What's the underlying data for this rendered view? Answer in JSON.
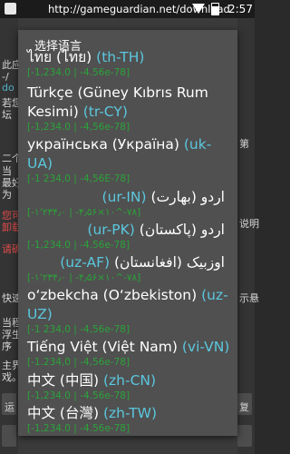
{
  "status_bar": {
    "url": "http://gameguardian.net/download",
    "time": "2:57",
    "icons": [
      "app-logo-icon",
      "wifi-icon",
      "battery-icon"
    ]
  },
  "background": {
    "fragments": [
      "此应",
      "-/",
      "do",
      "若您",
      "坛",
      "二个",
      "当",
      "最好",
      "为",
      "您可",
      "卸载",
      "请确",
      "快速",
      "当程",
      "浮生",
      "序",
      "主界",
      "戏。",
      "第",
      "说明",
      "示悬",
      "运",
      "复"
    ],
    "links": [
      "do"
    ]
  },
  "dialog": {
    "title": "选择语言",
    "items": [
      {
        "name": "ไทย (ไทย)",
        "code": "(th-TH)",
        "sample": "[-1,234.0 | -4.56e-78]"
      },
      {
        "name": "Türkçe (Güney Kıbrıs Rum Kesimi)",
        "code": "(tr-CY)",
        "sample": "[-1,234.0 | -4,56e-78]"
      },
      {
        "name": "українська (Україна)",
        "code": "(uk-UA)",
        "sample": "[-1 234,0 | -4,56E-78]"
      },
      {
        "name": "اردو (بھارت)",
        "code": "(ur-IN)",
        "sample": "[‎-۱٬۲۳۴٫۰ | ‎-۴٫۵۶×۱۰^‎-۷۸]",
        "rtl": true
      },
      {
        "name": "اردو (پاکستان)",
        "code": "(ur-PK)",
        "sample": "[-1,234.0 | -4.56e-78]",
        "rtl": true
      },
      {
        "name": "اوزبیک (افغانستان)",
        "code": "(uz-AF)",
        "sample": "[‎-۱٬۲۳۴٫۰ | ‎-۴٫۵۶×۱۰^‎-۷۸]",
        "rtl": true
      },
      {
        "name": "o‘zbekcha (O‘zbekiston)",
        "code": "(uz-UZ)",
        "sample": "[-1 234,0 | -4,56e-78]"
      },
      {
        "name": "Tiếng Việt (Việt Nam)",
        "code": "(vi-VN)",
        "sample": "[-1.234,0 | -4,56e-78]"
      },
      {
        "name": "中文 (中国)",
        "code": "(zh-CN)",
        "sample": "[-1,234.0 | -4.56e-78]"
      },
      {
        "name": "中文 (台灣)",
        "code": "(zh-TW)",
        "sample": "[-1,234.0 | -4.56e-78]"
      }
    ]
  }
}
